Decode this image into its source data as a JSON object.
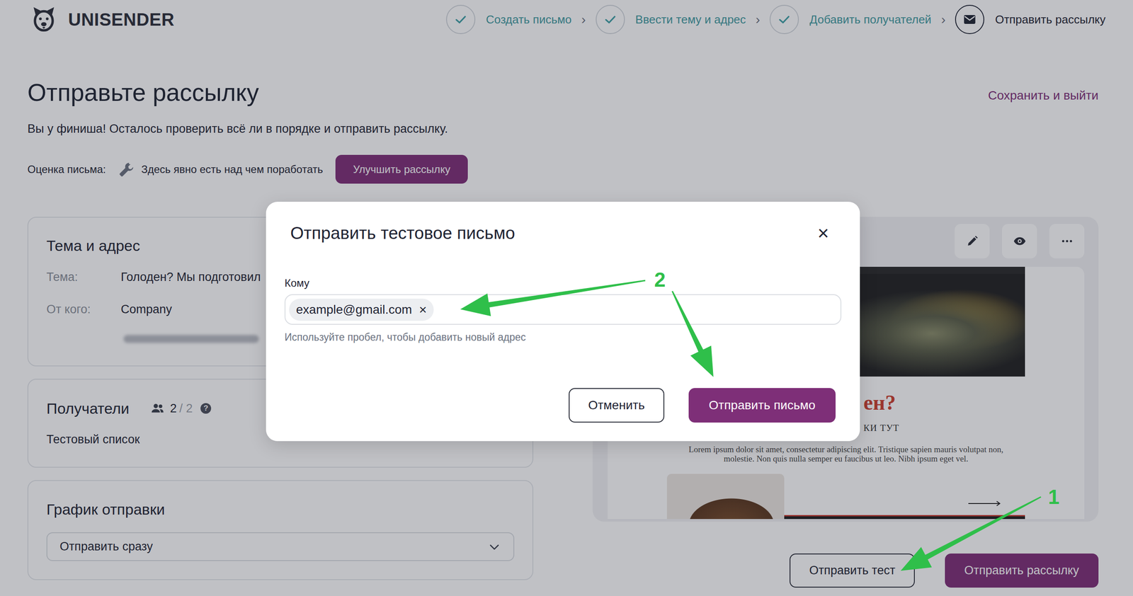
{
  "logo": {
    "text": "UNISENDER"
  },
  "steps": [
    {
      "label": "Создать письмо",
      "done": true,
      "selected": false
    },
    {
      "label": "Ввести тему и адрес",
      "done": true,
      "selected": false
    },
    {
      "label": "Добавить получателей",
      "done": true,
      "selected": false
    },
    {
      "label": "Отправить рассылку",
      "done": false,
      "selected": true
    }
  ],
  "step_separator": "›",
  "page": {
    "title": "Отправьте рассылку",
    "save_exit": "Сохранить и выйти",
    "subtitle": "Вы у финиша! Осталось проверить всё ли в порядке и отправить рассылку."
  },
  "rating": {
    "label": "Оценка письма:",
    "text": "Здесь явно есть над чем поработать",
    "button": "Улучшить рассылку"
  },
  "subject_card": {
    "title": "Тема и адрес",
    "fields": [
      {
        "label": "Тема:",
        "value": "Голоден? Мы подготовил"
      },
      {
        "label": "От кого:",
        "value": "Company"
      }
    ],
    "sender_email_blurred": true
  },
  "recipients_card": {
    "title": "Получатели",
    "count": "2",
    "separator": "/",
    "total": "2",
    "help": "?",
    "list": "Тестовый список"
  },
  "schedule_card": {
    "title": "График отправки",
    "select": "Отправить сразу"
  },
  "preview": {
    "heading": "ен?",
    "subheading": "КИ ТУТ",
    "body": "Lorem ipsum dolor sit amet, consectetur adipiscing elit. Tristique sapien mauris volutpat non, molestie. Non quis nulla semper eu faucibus ut leo. Nibh ipsum eget vel."
  },
  "actions": [
    {
      "label": "Отправить тест",
      "primary": false
    },
    {
      "label": "Отправить рассылку",
      "primary": true
    }
  ],
  "modal": {
    "title": "Отправить тестовое письмо",
    "close": "×",
    "field_label": "Кому",
    "chips": [
      {
        "text": "example@gmail.com",
        "remove": "×"
      }
    ],
    "hint": "Используйте пробел, чтобы добавить новый адрес",
    "buttons": [
      {
        "label": "Отменить",
        "primary": false
      },
      {
        "label": "Отправить письмо",
        "primary": true
      }
    ]
  },
  "annotations": [
    {
      "number": "1"
    },
    {
      "number": "2"
    }
  ]
}
